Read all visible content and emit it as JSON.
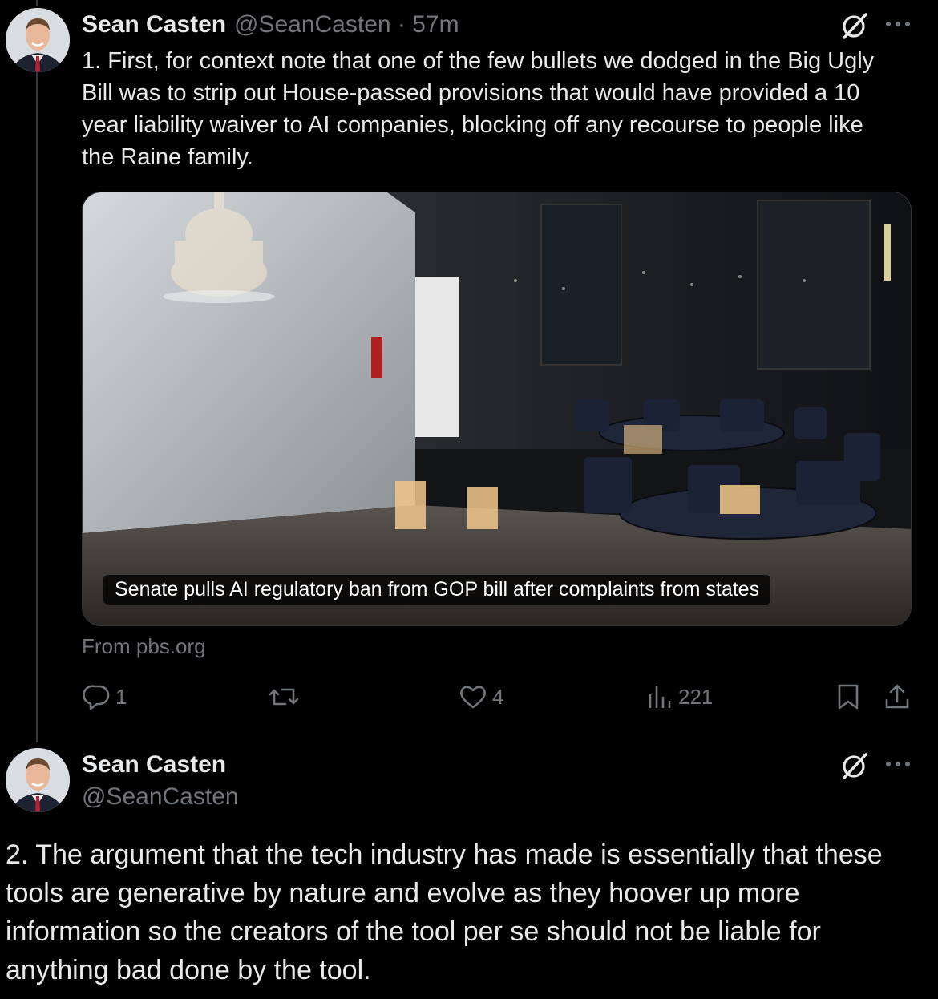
{
  "tweet1": {
    "display_name": "Sean Casten",
    "handle_time": "@SeanCasten · 57m",
    "text": "1. First, for context note that one of the few bullets we dodged in the Big Ugly Bill was to strip out House-passed provisions that would have provided a 10 year liability waiver to AI companies, blocking off any recourse to people like the Raine family.",
    "card": {
      "caption": "Senate pulls AI regulatory ban from GOP bill after complaints from states",
      "source": "From pbs.org"
    },
    "actions": {
      "reply_count": "1",
      "retweet_count": "",
      "like_count": "4",
      "view_count": "221"
    }
  },
  "tweet2": {
    "display_name": "Sean Casten",
    "handle": "@SeanCasten",
    "text": "2. The argument that the tech industry has made is essentially that these tools are generative by nature and evolve as they hoover up more information so the creators of the tool per se should not be liable for anything bad done by the tool."
  },
  "colors": {
    "background": "#000000",
    "text_primary": "#e7e9ea",
    "text_secondary": "#71767b",
    "divider": "#333639"
  },
  "icons": [
    "grok-icon",
    "more-icon",
    "reply-icon",
    "retweet-icon",
    "like-icon",
    "views-icon",
    "bookmark-icon",
    "share-icon"
  ]
}
